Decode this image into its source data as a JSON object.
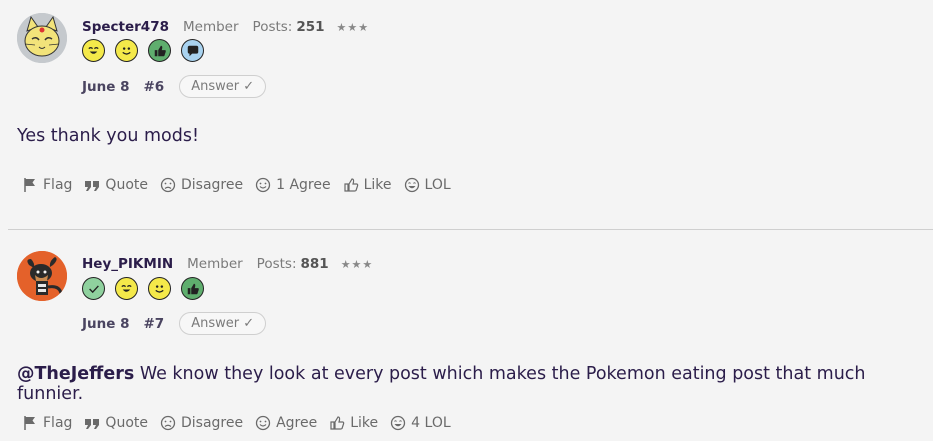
{
  "posts": [
    {
      "username": "Specter478",
      "role": "Member",
      "posts_label": "Posts:",
      "posts_count": "251",
      "stars": "★★★",
      "date": "June 8",
      "number": "#6",
      "answer_label": "Answer ✓",
      "body": "Yes thank you mods!",
      "badges": [
        "grin-badge",
        "smile-badge",
        "thumbs-up-badge",
        "speech-bubble-badge"
      ],
      "actions": {
        "flag": "Flag",
        "quote": "Quote",
        "disagree": "Disagree",
        "agree": "1 Agree",
        "like": "Like",
        "lol": "LOL"
      }
    },
    {
      "username": "Hey_PIKMIN",
      "role": "Member",
      "posts_label": "Posts:",
      "posts_count": "881",
      "stars": "★★★",
      "date": "June 8",
      "number": "#7",
      "answer_label": "Answer ✓",
      "mention": "@TheJeffers",
      "body": " We know they look at every post which makes the Pokemon eating post that much funnier.",
      "badges": [
        "check-badge",
        "grin-badge",
        "smile-badge",
        "thumbs-up-badge"
      ],
      "actions": {
        "flag": "Flag",
        "quote": "Quote",
        "disagree": "Disagree",
        "agree": "Agree",
        "like": "Like",
        "lol": "4 LOL"
      }
    }
  ],
  "colors": {
    "text": "#2b1d4a",
    "muted": "#7a7a7a",
    "yellow_badge": "#f4e94a",
    "green_badge": "#5fae6e",
    "blue_badge": "#a9d3f0",
    "light_green_badge": "#8fd19e"
  }
}
